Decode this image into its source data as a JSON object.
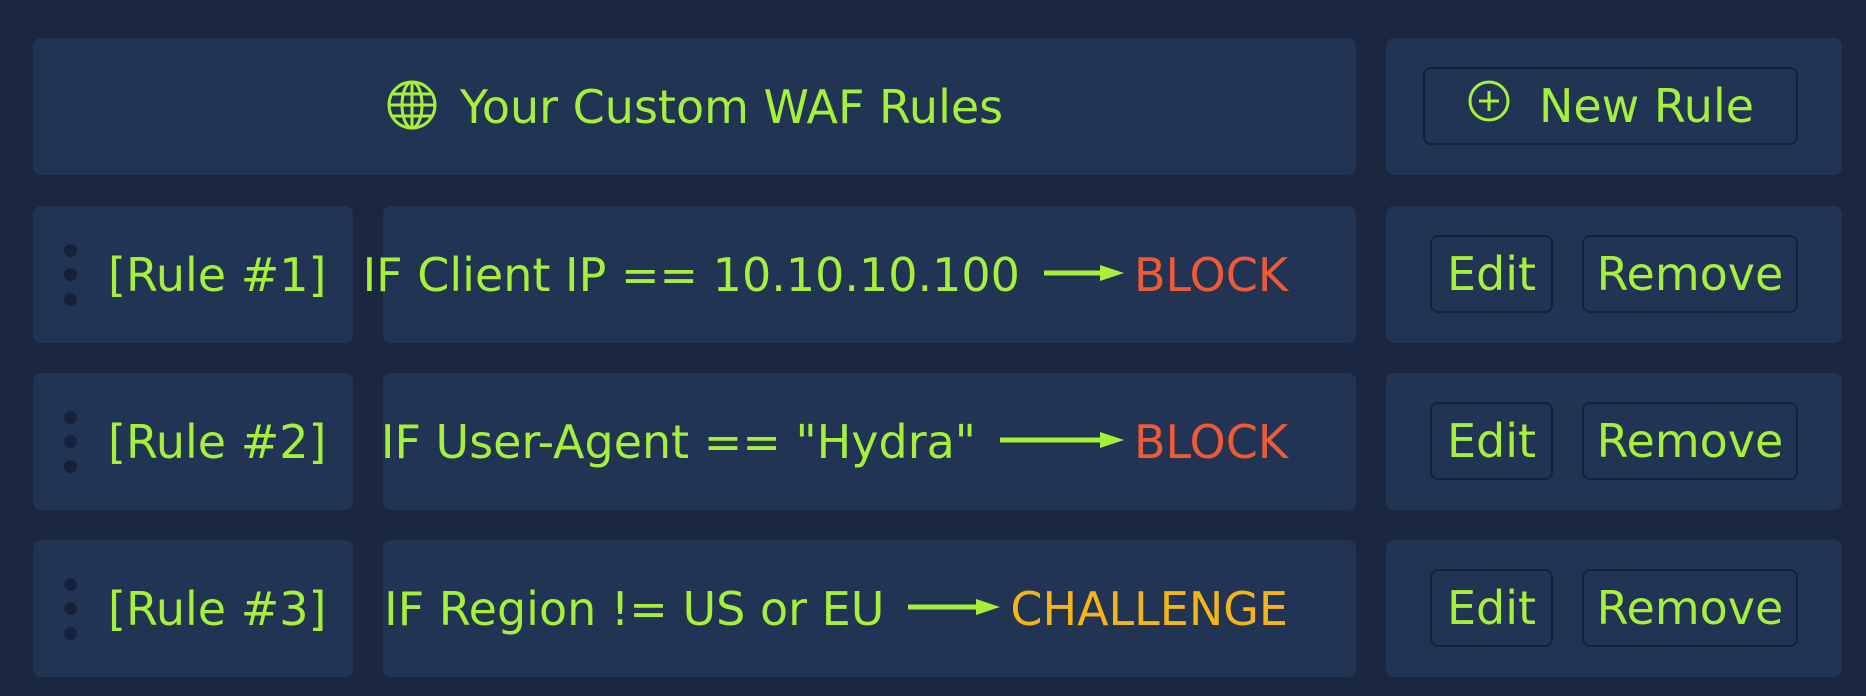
{
  "header": {
    "title": "Your Custom WAF Rules",
    "icon": "globe-icon"
  },
  "new_rule_button": {
    "label": "New Rule",
    "icon": "plus-circle-icon"
  },
  "rules": [
    {
      "label": "[Rule #1]",
      "condition": "IF Client IP == 10.10.10.100",
      "action": "BLOCK",
      "action_color": "#ee5a36",
      "edit_label": "Edit",
      "remove_label": "Remove"
    },
    {
      "label": "[Rule #2]",
      "condition": "IF User-Agent == \"Hydra\"",
      "action": "BLOCK",
      "action_color": "#ee5a36",
      "edit_label": "Edit",
      "remove_label": "Remove"
    },
    {
      "label": "[Rule #3]",
      "condition": "IF Region != US or EU",
      "action": "CHALLENGE",
      "action_color": "#f3b518",
      "edit_label": "Edit",
      "remove_label": "Remove"
    }
  ],
  "colors": {
    "background": "#1b2640",
    "panel": "#223454",
    "accent": "#a6ef3a",
    "block": "#ee5a36",
    "challenge": "#f3b518"
  }
}
